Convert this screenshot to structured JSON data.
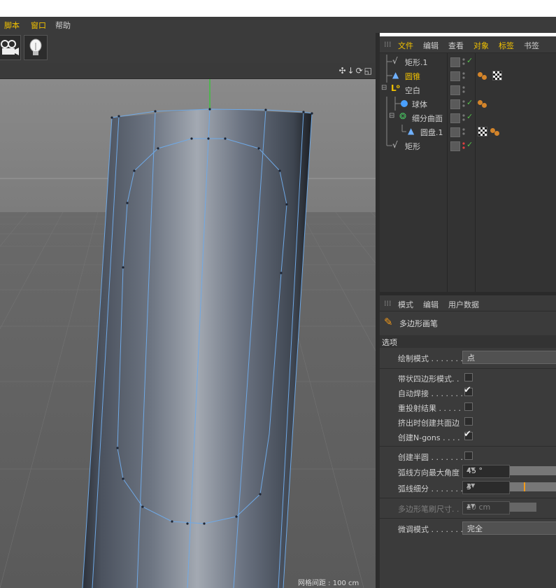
{
  "menu": {
    "script": "脚本",
    "window": "窗口",
    "help": "帮助"
  },
  "toolbar": {
    "camera_icon": "film-camera-icon",
    "light_icon": "lightbulb-icon"
  },
  "viewport": {
    "grid_spacing": "网格间距 : 100 cm",
    "nav_icons": "✣↓⟳◱"
  },
  "object_manager": {
    "tabs": [
      "文件",
      "编辑",
      "查看",
      "对象",
      "标签",
      "书签"
    ],
    "objects": [
      {
        "name": "矩形.1"
      },
      {
        "name": "圆锥"
      },
      {
        "name": "空白"
      },
      {
        "name": "球体"
      },
      {
        "name": "细分曲面"
      },
      {
        "name": "圆盘.1"
      },
      {
        "name": "矩形"
      }
    ]
  },
  "attributes": {
    "tabs": [
      "模式",
      "编辑",
      "用户数据"
    ],
    "tool_name": "多边形画笔",
    "section": "选项",
    "draw_mode_label": "绘制模式 . . . . . . .",
    "draw_mode_value": "点",
    "quad_strip_label": "带状四边形模式. .",
    "auto_weld_label": "自动焊接 . . . . . . .",
    "reproject_label": "重投射结果 . . . . .",
    "extrude_shared_label": "挤出时创建共面边",
    "create_ngons_label": "创建N-gons . . . .",
    "create_semicircle_label": "创建半圆 . . . . . . .",
    "arc_max_angle_label": "弧线方向最大角度",
    "arc_max_angle_value": "45 °",
    "arc_subdiv_label": "弧线细分 . . . . . . .",
    "arc_subdiv_value": "3",
    "brush_size_label": "多边形笔刷尺寸. .",
    "brush_size_value": "20 cm",
    "tweak_mode_label": "微调模式 . . . . . . .",
    "tweak_mode_value": "完全"
  },
  "colors": {
    "accent": "#f2c200",
    "check": "#55c04a",
    "tag_orange": "#d3842a"
  }
}
